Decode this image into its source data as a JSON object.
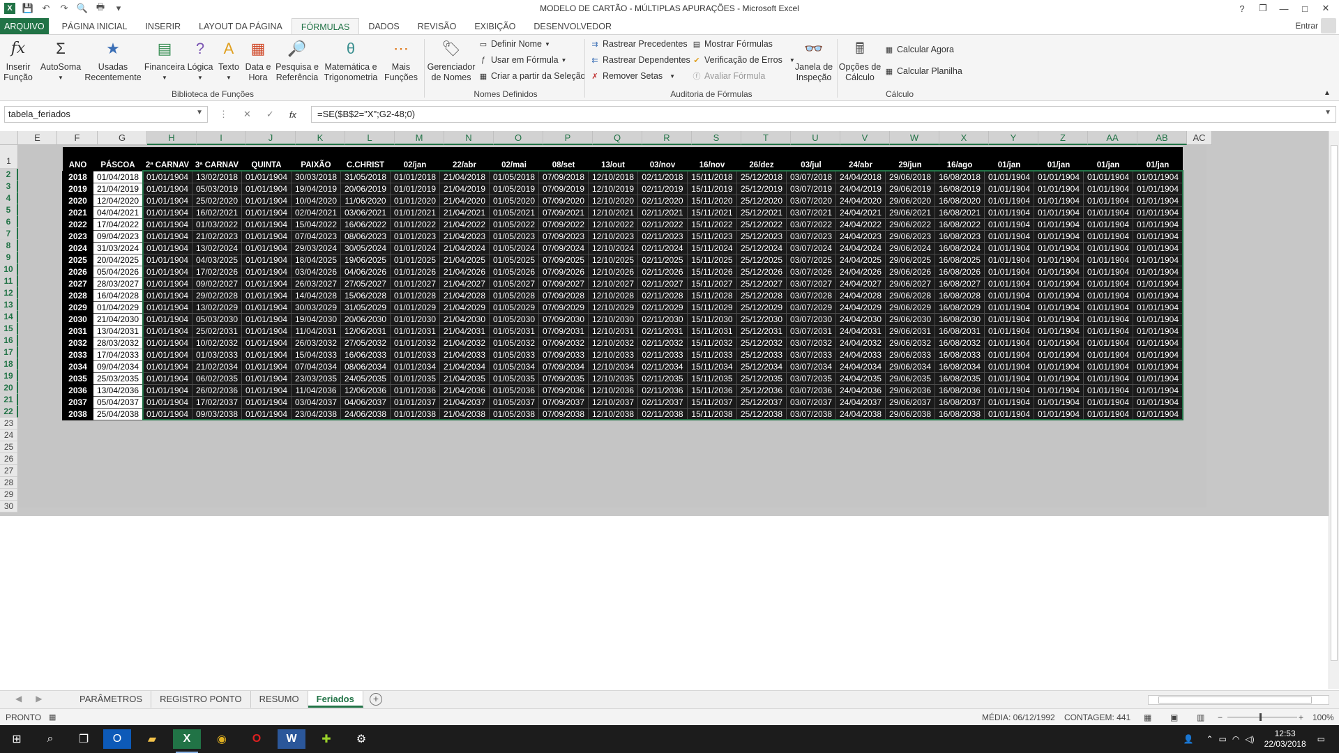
{
  "window": {
    "title": "MODELO DE CARTÃO - MÚLTIPLAS APURAÇÕES - Microsoft Excel",
    "help": "?",
    "restore": "❐",
    "minimize": "—",
    "maximize": "□",
    "close": "✕"
  },
  "tabs": {
    "file": "ARQUIVO",
    "items": [
      "PÁGINA INICIAL",
      "INSERIR",
      "LAYOUT DA PÁGINA",
      "FÓRMULAS",
      "DADOS",
      "REVISÃO",
      "EXIBIÇÃO",
      "DESENVOLVEDOR"
    ],
    "active": "FÓRMULAS",
    "signin": "Entrar"
  },
  "ribbon": {
    "insert_function": "Inserir\nFunção",
    "autosum": "AutoSoma",
    "recent": "Usadas\nRecentemente",
    "financial": "Financeira",
    "logical": "Lógica",
    "text": "Texto",
    "datetime": "Data e\nHora",
    "lookup": "Pesquisa e\nReferência",
    "math": "Matemática e\nTrigonometria",
    "more": "Mais\nFunções",
    "group_library": "Biblioteca de Funções",
    "name_manager": "Gerenciador\nde Nomes",
    "define_name": "Definir Nome",
    "use_in_formula": "Usar em Fórmula",
    "create_from_selection": "Criar a partir da Seleção",
    "group_names": "Nomes Definidos",
    "trace_precedents": "Rastrear Precedentes",
    "trace_dependents": "Rastrear Dependentes",
    "remove_arrows": "Remover Setas",
    "show_formulas": "Mostrar Fórmulas",
    "error_checking": "Verificação de Erros",
    "evaluate_formula": "Avaliar Fórmula",
    "watch_window": "Janela de\nInspeção",
    "group_audit": "Auditoria de Fórmulas",
    "calc_options": "Opções de\nCálculo",
    "calc_now": "Calcular Agora",
    "calc_sheet": "Calcular Planilha",
    "group_calc": "Cálculo"
  },
  "formula_bar": {
    "name_box": "tabela_feriados",
    "formula": "=SE($B$2=\"X\";G2-48;0)",
    "fx": "fx"
  },
  "columns": [
    "E",
    "F",
    "G",
    "H",
    "I",
    "J",
    "K",
    "L",
    "M",
    "N",
    "O",
    "P",
    "Q",
    "R",
    "S",
    "T",
    "U",
    "V",
    "W",
    "X",
    "Y",
    "Z",
    "AA",
    "AB",
    "AC"
  ],
  "rows": [
    "1",
    "2",
    "3",
    "4",
    "5",
    "6",
    "7",
    "8",
    "9",
    "10",
    "11",
    "12",
    "13",
    "14",
    "15",
    "16",
    "17",
    "18",
    "19",
    "20",
    "21",
    "22",
    "23",
    "24",
    "25",
    "26",
    "27",
    "28",
    "29",
    "30"
  ],
  "table": {
    "headers": [
      "ANO",
      "PÁSCOA",
      "2ª CARNAV",
      "3ª CARNAV",
      "QUINTA",
      "PAIXÃO",
      "C.CHRIST",
      "02/jan",
      "22/abr",
      "02/mai",
      "08/set",
      "13/out",
      "03/nov",
      "16/nov",
      "26/dez",
      "03/jul",
      "24/abr",
      "29/jun",
      "16/ago",
      "01/jan",
      "01/jan",
      "01/jan",
      "01/jan"
    ],
    "rows": [
      [
        "2018",
        "01/04/2018",
        "01/01/1904",
        "13/02/2018",
        "01/01/1904",
        "30/03/2018",
        "31/05/2018",
        "01/01/2018",
        "21/04/2018",
        "01/05/2018",
        "07/09/2018",
        "12/10/2018",
        "02/11/2018",
        "15/11/2018",
        "25/12/2018",
        "03/07/2018",
        "24/04/2018",
        "29/06/2018",
        "16/08/2018",
        "01/01/1904",
        "01/01/1904",
        "01/01/1904",
        "01/01/1904"
      ],
      [
        "2019",
        "21/04/2019",
        "01/01/1904",
        "05/03/2019",
        "01/01/1904",
        "19/04/2019",
        "20/06/2019",
        "01/01/2019",
        "21/04/2019",
        "01/05/2019",
        "07/09/2019",
        "12/10/2019",
        "02/11/2019",
        "15/11/2019",
        "25/12/2019",
        "03/07/2019",
        "24/04/2019",
        "29/06/2019",
        "16/08/2019",
        "01/01/1904",
        "01/01/1904",
        "01/01/1904",
        "01/01/1904"
      ],
      [
        "2020",
        "12/04/2020",
        "01/01/1904",
        "25/02/2020",
        "01/01/1904",
        "10/04/2020",
        "11/06/2020",
        "01/01/2020",
        "21/04/2020",
        "01/05/2020",
        "07/09/2020",
        "12/10/2020",
        "02/11/2020",
        "15/11/2020",
        "25/12/2020",
        "03/07/2020",
        "24/04/2020",
        "29/06/2020",
        "16/08/2020",
        "01/01/1904",
        "01/01/1904",
        "01/01/1904",
        "01/01/1904"
      ],
      [
        "2021",
        "04/04/2021",
        "01/01/1904",
        "16/02/2021",
        "01/01/1904",
        "02/04/2021",
        "03/06/2021",
        "01/01/2021",
        "21/04/2021",
        "01/05/2021",
        "07/09/2021",
        "12/10/2021",
        "02/11/2021",
        "15/11/2021",
        "25/12/2021",
        "03/07/2021",
        "24/04/2021",
        "29/06/2021",
        "16/08/2021",
        "01/01/1904",
        "01/01/1904",
        "01/01/1904",
        "01/01/1904"
      ],
      [
        "2022",
        "17/04/2022",
        "01/01/1904",
        "01/03/2022",
        "01/01/1904",
        "15/04/2022",
        "16/06/2022",
        "01/01/2022",
        "21/04/2022",
        "01/05/2022",
        "07/09/2022",
        "12/10/2022",
        "02/11/2022",
        "15/11/2022",
        "25/12/2022",
        "03/07/2022",
        "24/04/2022",
        "29/06/2022",
        "16/08/2022",
        "01/01/1904",
        "01/01/1904",
        "01/01/1904",
        "01/01/1904"
      ],
      [
        "2023",
        "09/04/2023",
        "01/01/1904",
        "21/02/2023",
        "01/01/1904",
        "07/04/2023",
        "08/06/2023",
        "01/01/2023",
        "21/04/2023",
        "01/05/2023",
        "07/09/2023",
        "12/10/2023",
        "02/11/2023",
        "15/11/2023",
        "25/12/2023",
        "03/07/2023",
        "24/04/2023",
        "29/06/2023",
        "16/08/2023",
        "01/01/1904",
        "01/01/1904",
        "01/01/1904",
        "01/01/1904"
      ],
      [
        "2024",
        "31/03/2024",
        "01/01/1904",
        "13/02/2024",
        "01/01/1904",
        "29/03/2024",
        "30/05/2024",
        "01/01/2024",
        "21/04/2024",
        "01/05/2024",
        "07/09/2024",
        "12/10/2024",
        "02/11/2024",
        "15/11/2024",
        "25/12/2024",
        "03/07/2024",
        "24/04/2024",
        "29/06/2024",
        "16/08/2024",
        "01/01/1904",
        "01/01/1904",
        "01/01/1904",
        "01/01/1904"
      ],
      [
        "2025",
        "20/04/2025",
        "01/01/1904",
        "04/03/2025",
        "01/01/1904",
        "18/04/2025",
        "19/06/2025",
        "01/01/2025",
        "21/04/2025",
        "01/05/2025",
        "07/09/2025",
        "12/10/2025",
        "02/11/2025",
        "15/11/2025",
        "25/12/2025",
        "03/07/2025",
        "24/04/2025",
        "29/06/2025",
        "16/08/2025",
        "01/01/1904",
        "01/01/1904",
        "01/01/1904",
        "01/01/1904"
      ],
      [
        "2026",
        "05/04/2026",
        "01/01/1904",
        "17/02/2026",
        "01/01/1904",
        "03/04/2026",
        "04/06/2026",
        "01/01/2026",
        "21/04/2026",
        "01/05/2026",
        "07/09/2026",
        "12/10/2026",
        "02/11/2026",
        "15/11/2026",
        "25/12/2026",
        "03/07/2026",
        "24/04/2026",
        "29/06/2026",
        "16/08/2026",
        "01/01/1904",
        "01/01/1904",
        "01/01/1904",
        "01/01/1904"
      ],
      [
        "2027",
        "28/03/2027",
        "01/01/1904",
        "09/02/2027",
        "01/01/1904",
        "26/03/2027",
        "27/05/2027",
        "01/01/2027",
        "21/04/2027",
        "01/05/2027",
        "07/09/2027",
        "12/10/2027",
        "02/11/2027",
        "15/11/2027",
        "25/12/2027",
        "03/07/2027",
        "24/04/2027",
        "29/06/2027",
        "16/08/2027",
        "01/01/1904",
        "01/01/1904",
        "01/01/1904",
        "01/01/1904"
      ],
      [
        "2028",
        "16/04/2028",
        "01/01/1904",
        "29/02/2028",
        "01/01/1904",
        "14/04/2028",
        "15/06/2028",
        "01/01/2028",
        "21/04/2028",
        "01/05/2028",
        "07/09/2028",
        "12/10/2028",
        "02/11/2028",
        "15/11/2028",
        "25/12/2028",
        "03/07/2028",
        "24/04/2028",
        "29/06/2028",
        "16/08/2028",
        "01/01/1904",
        "01/01/1904",
        "01/01/1904",
        "01/01/1904"
      ],
      [
        "2029",
        "01/04/2029",
        "01/01/1904",
        "13/02/2029",
        "01/01/1904",
        "30/03/2029",
        "31/05/2029",
        "01/01/2029",
        "21/04/2029",
        "01/05/2029",
        "07/09/2029",
        "12/10/2029",
        "02/11/2029",
        "15/11/2029",
        "25/12/2029",
        "03/07/2029",
        "24/04/2029",
        "29/06/2029",
        "16/08/2029",
        "01/01/1904",
        "01/01/1904",
        "01/01/1904",
        "01/01/1904"
      ],
      [
        "2030",
        "21/04/2030",
        "01/01/1904",
        "05/03/2030",
        "01/01/1904",
        "19/04/2030",
        "20/06/2030",
        "01/01/2030",
        "21/04/2030",
        "01/05/2030",
        "07/09/2030",
        "12/10/2030",
        "02/11/2030",
        "15/11/2030",
        "25/12/2030",
        "03/07/2030",
        "24/04/2030",
        "29/06/2030",
        "16/08/2030",
        "01/01/1904",
        "01/01/1904",
        "01/01/1904",
        "01/01/1904"
      ],
      [
        "2031",
        "13/04/2031",
        "01/01/1904",
        "25/02/2031",
        "01/01/1904",
        "11/04/2031",
        "12/06/2031",
        "01/01/2031",
        "21/04/2031",
        "01/05/2031",
        "07/09/2031",
        "12/10/2031",
        "02/11/2031",
        "15/11/2031",
        "25/12/2031",
        "03/07/2031",
        "24/04/2031",
        "29/06/2031",
        "16/08/2031",
        "01/01/1904",
        "01/01/1904",
        "01/01/1904",
        "01/01/1904"
      ],
      [
        "2032",
        "28/03/2032",
        "01/01/1904",
        "10/02/2032",
        "01/01/1904",
        "26/03/2032",
        "27/05/2032",
        "01/01/2032",
        "21/04/2032",
        "01/05/2032",
        "07/09/2032",
        "12/10/2032",
        "02/11/2032",
        "15/11/2032",
        "25/12/2032",
        "03/07/2032",
        "24/04/2032",
        "29/06/2032",
        "16/08/2032",
        "01/01/1904",
        "01/01/1904",
        "01/01/1904",
        "01/01/1904"
      ],
      [
        "2033",
        "17/04/2033",
        "01/01/1904",
        "01/03/2033",
        "01/01/1904",
        "15/04/2033",
        "16/06/2033",
        "01/01/2033",
        "21/04/2033",
        "01/05/2033",
        "07/09/2033",
        "12/10/2033",
        "02/11/2033",
        "15/11/2033",
        "25/12/2033",
        "03/07/2033",
        "24/04/2033",
        "29/06/2033",
        "16/08/2033",
        "01/01/1904",
        "01/01/1904",
        "01/01/1904",
        "01/01/1904"
      ],
      [
        "2034",
        "09/04/2034",
        "01/01/1904",
        "21/02/2034",
        "01/01/1904",
        "07/04/2034",
        "08/06/2034",
        "01/01/2034",
        "21/04/2034",
        "01/05/2034",
        "07/09/2034",
        "12/10/2034",
        "02/11/2034",
        "15/11/2034",
        "25/12/2034",
        "03/07/2034",
        "24/04/2034",
        "29/06/2034",
        "16/08/2034",
        "01/01/1904",
        "01/01/1904",
        "01/01/1904",
        "01/01/1904"
      ],
      [
        "2035",
        "25/03/2035",
        "01/01/1904",
        "06/02/2035",
        "01/01/1904",
        "23/03/2035",
        "24/05/2035",
        "01/01/2035",
        "21/04/2035",
        "01/05/2035",
        "07/09/2035",
        "12/10/2035",
        "02/11/2035",
        "15/11/2035",
        "25/12/2035",
        "03/07/2035",
        "24/04/2035",
        "29/06/2035",
        "16/08/2035",
        "01/01/1904",
        "01/01/1904",
        "01/01/1904",
        "01/01/1904"
      ],
      [
        "2036",
        "13/04/2036",
        "01/01/1904",
        "26/02/2036",
        "01/01/1904",
        "11/04/2036",
        "12/06/2036",
        "01/01/2036",
        "21/04/2036",
        "01/05/2036",
        "07/09/2036",
        "12/10/2036",
        "02/11/2036",
        "15/11/2036",
        "25/12/2036",
        "03/07/2036",
        "24/04/2036",
        "29/06/2036",
        "16/08/2036",
        "01/01/1904",
        "01/01/1904",
        "01/01/1904",
        "01/01/1904"
      ],
      [
        "2037",
        "05/04/2037",
        "01/01/1904",
        "17/02/2037",
        "01/01/1904",
        "03/04/2037",
        "04/06/2037",
        "01/01/2037",
        "21/04/2037",
        "01/05/2037",
        "07/09/2037",
        "12/10/2037",
        "02/11/2037",
        "15/11/2037",
        "25/12/2037",
        "03/07/2037",
        "24/04/2037",
        "29/06/2037",
        "16/08/2037",
        "01/01/1904",
        "01/01/1904",
        "01/01/1904",
        "01/01/1904"
      ],
      [
        "2038",
        "25/04/2038",
        "01/01/1904",
        "09/03/2038",
        "01/01/1904",
        "23/04/2038",
        "24/06/2038",
        "01/01/2038",
        "21/04/2038",
        "01/05/2038",
        "07/09/2038",
        "12/10/2038",
        "02/11/2038",
        "15/11/2038",
        "25/12/2038",
        "03/07/2038",
        "24/04/2038",
        "29/06/2038",
        "16/08/2038",
        "01/01/1904",
        "01/01/1904",
        "01/01/1904",
        "01/01/1904"
      ]
    ]
  },
  "sheets": [
    "PARÂMETROS",
    "REGISTRO PONTO",
    "RESUMO",
    "Feriados"
  ],
  "active_sheet": "Feriados",
  "status": {
    "ready": "PRONTO",
    "average": "MÉDIA: 06/12/1992",
    "count": "CONTAGEM: 441",
    "zoom": "100%"
  },
  "taskbar": {
    "time": "12:53",
    "date": "22/03/2018"
  },
  "colors": {
    "excel_green": "#217346",
    "header_black": "#000000"
  }
}
